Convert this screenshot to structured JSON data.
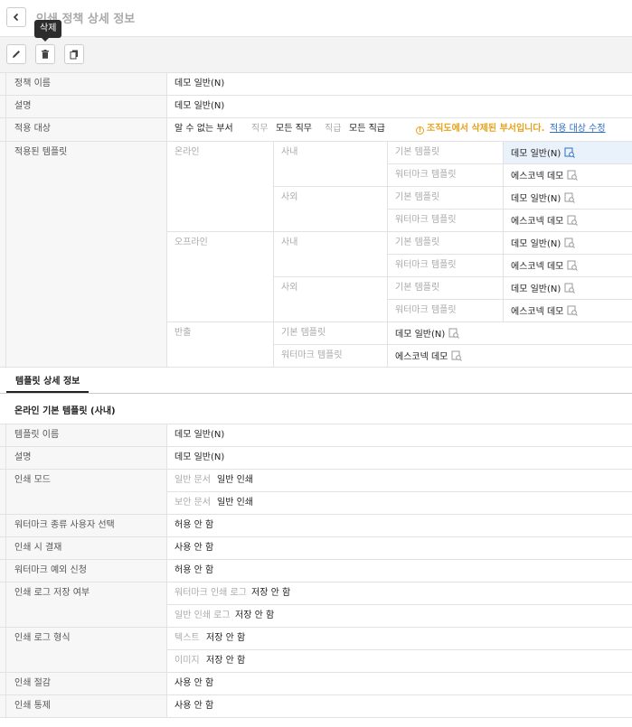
{
  "header": {
    "title": "인쇄 정책 상세 정보"
  },
  "toolbar": {
    "delete_tooltip": "삭제"
  },
  "policy": {
    "name_label": "정책 이름",
    "name_value": "데모 일반(N)",
    "desc_label": "설명",
    "desc_value": "데모 일반(N)",
    "target_label": "적용 대상",
    "target_dept": "알 수 없는 부서",
    "target_duty_label": "직무",
    "target_duty_value": "모든 직무",
    "target_rank_label": "직급",
    "target_rank_value": "모든 직급",
    "warning": "조직도에서 삭제된 부서입니다.",
    "edit_link": "적용 대상 수정",
    "templates_label": "적용된 템플릿",
    "online": "온라인",
    "offline": "오프라인",
    "export": "반출",
    "internal": "사내",
    "external": "사외",
    "basic_template": "기본 템플릿",
    "watermark_template": "워터마크 템플릿",
    "basic_value": "데모 일반(N)",
    "watermark_value": "에스코넥 데모"
  },
  "tabs": {
    "template_detail": "템플릿 상세 정보"
  },
  "detail": {
    "section_title": "온라인 기본 템플릿 (사내)",
    "name_label": "템플릿 이름",
    "name_value": "데모 일반(N)",
    "desc_label": "설명",
    "desc_value": "데모 일반(N)",
    "print_mode_label": "인쇄 모드",
    "normal_doc_label": "일반 문서",
    "normal_doc_value": "일반 인쇄",
    "secure_doc_label": "보안 문서",
    "secure_doc_value": "일반 인쇄",
    "wm_user_select_label": "워터마크 종류 사용자 선택",
    "wm_user_select_value": "허용 안 함",
    "print_approval_label": "인쇄 시 결재",
    "print_approval_value": "사용 안 함",
    "wm_exception_label": "워터마크 예외 신청",
    "wm_exception_value": "허용 안 함",
    "log_save_label": "인쇄 로그 저장 여부",
    "wm_log_label": "워터마크 인쇄 로그",
    "wm_log_value": "저장 안 함",
    "normal_log_label": "일반 인쇄 로그",
    "normal_log_value": "저장 안 함",
    "log_format_label": "인쇄 로그 형식",
    "text_label": "텍스트",
    "text_value": "저장 안 함",
    "image_label": "이미지",
    "image_value": "저장 안 함",
    "print_saving_label": "인쇄 절감",
    "print_saving_value": "사용 안 함",
    "print_control_label": "인쇄 통제",
    "print_control_value": "사용 안 함"
  }
}
